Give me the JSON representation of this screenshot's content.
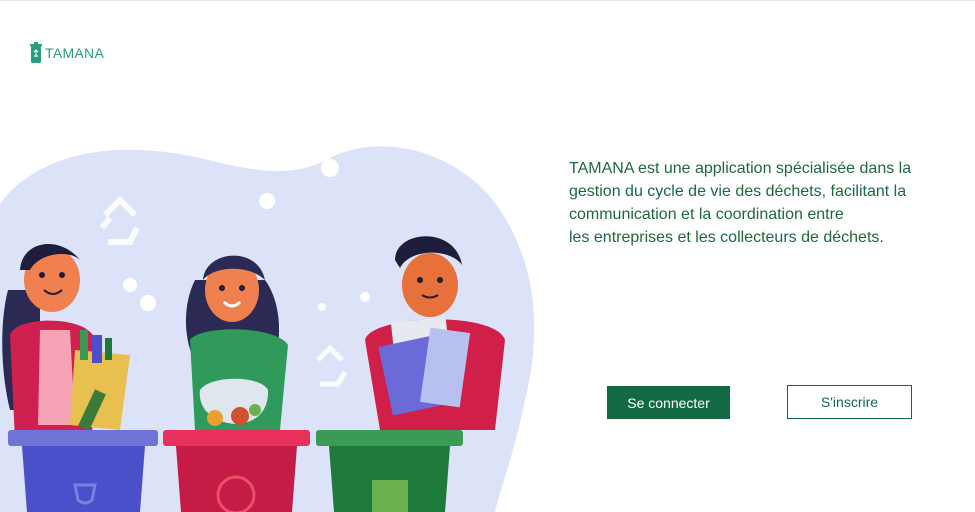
{
  "app": {
    "logo_icon": "recycle-bin-icon",
    "name": "TAMANA",
    "brand_color": "#2a9d7f"
  },
  "hero": {
    "description_lines": [
      "TAMANA est une application spécialisée dans la",
      "gestion du cycle de vie des déchets, facilitant la",
      "communication et la coordination entre",
      "les entreprises et les collecteurs de déchets."
    ],
    "text_color": "#1e6a3e",
    "illustration": "people-sorting-waste-into-recycling-bins",
    "bin_colors": [
      "#4a50c9",
      "#e02050",
      "#1e7a3a"
    ]
  },
  "actions": {
    "login_label": "Se connecter",
    "register_label": "S'inscrire",
    "primary_color": "#136a42"
  }
}
